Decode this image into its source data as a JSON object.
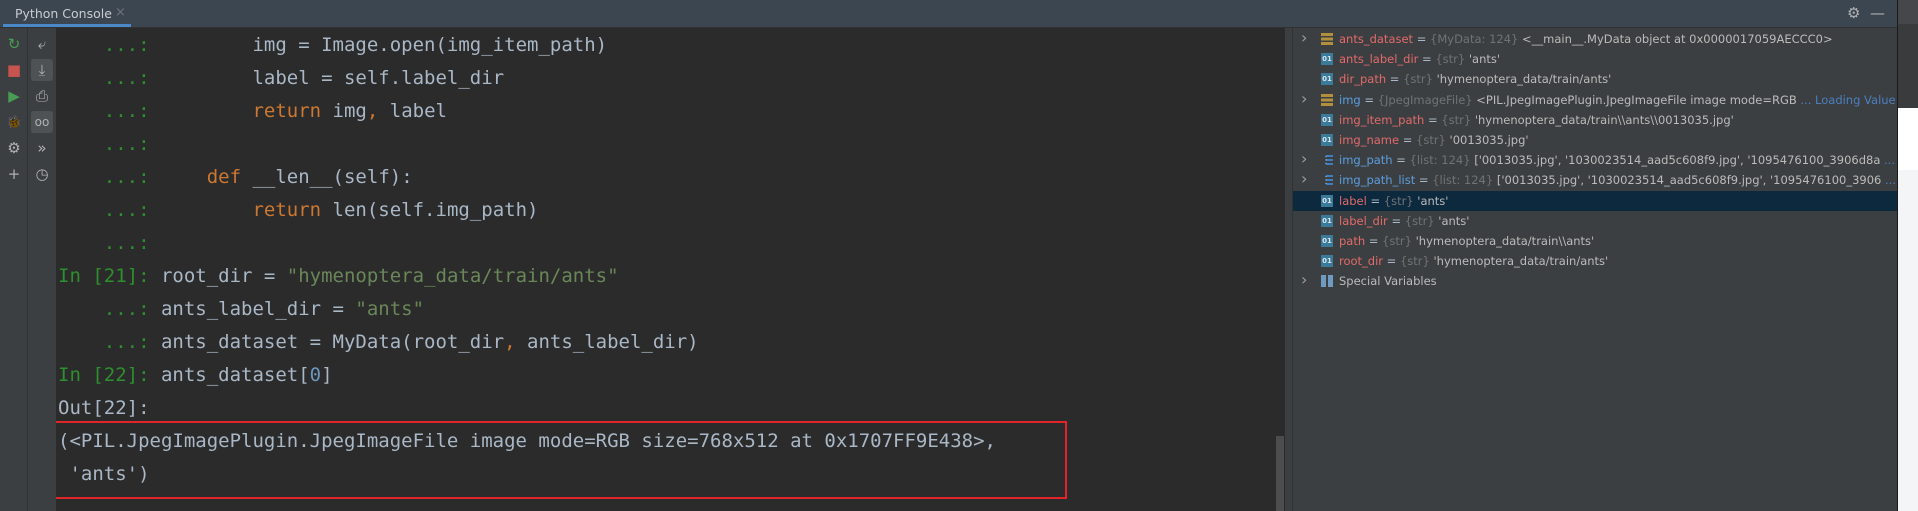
{
  "header": {
    "tab_label": "Python Console",
    "tab_close_icon": "×",
    "settings_icon": "⚙",
    "minimize_icon": "—"
  },
  "toolbar": {
    "primary": [
      {
        "name": "rerun-icon",
        "glyph": "↻",
        "color": "#499c54"
      },
      {
        "name": "stop-icon",
        "glyph": "■",
        "color": "#c75450"
      },
      {
        "name": "execute-icon",
        "glyph": "▶",
        "color": "#499c54"
      },
      {
        "name": "debug-icon",
        "glyph": "🐞",
        "color": "#499c54"
      },
      {
        "name": "settings-icon",
        "glyph": "⚙",
        "color": "#afb1b3"
      },
      {
        "name": "add-icon",
        "glyph": "+",
        "color": "#afb1b3"
      }
    ],
    "secondary": [
      {
        "name": "soft-wrap-icon",
        "glyph": "⤶",
        "active": false
      },
      {
        "name": "scroll-to-end-icon",
        "glyph": "⤓",
        "active": true
      },
      {
        "name": "print-icon",
        "glyph": "⎙",
        "active": false
      },
      {
        "name": "show-variables-icon",
        "glyph": "oo",
        "active": true
      },
      {
        "name": "execute-history-icon",
        "glyph": "»",
        "active": false
      },
      {
        "name": "history-icon",
        "glyph": "◷",
        "active": false
      }
    ]
  },
  "console": {
    "lines": [
      {
        "prompt": "    ...: ",
        "indent": "        ",
        "segments": [
          [
            "img = Image.open(img_item_path)",
            "code"
          ]
        ]
      },
      {
        "prompt": "    ...: ",
        "indent": "        ",
        "segments": [
          [
            "label = self.label_dir",
            "code"
          ]
        ]
      },
      {
        "prompt": "    ...: ",
        "indent": "        ",
        "segments": [
          [
            "return",
            "kw"
          ],
          [
            " img",
            "code"
          ],
          [
            ",",
            "kw"
          ],
          [
            " label",
            "code"
          ]
        ]
      },
      {
        "prompt": "    ...: ",
        "indent": "",
        "segments": []
      },
      {
        "prompt": "    ...: ",
        "indent": "    ",
        "segments": [
          [
            "def",
            "kw"
          ],
          [
            " __len__(self):",
            "code"
          ]
        ]
      },
      {
        "prompt": "    ...: ",
        "indent": "        ",
        "segments": [
          [
            "return",
            "kw"
          ],
          [
            " len(self.img_path)",
            "code"
          ]
        ]
      },
      {
        "prompt": "    ...: ",
        "indent": "",
        "segments": []
      },
      {
        "prompt": "In [21]: ",
        "indent": "",
        "segments": [
          [
            "root_dir = ",
            "code"
          ],
          [
            "\"hymenoptera_data/train/ants\"",
            "str"
          ]
        ]
      },
      {
        "prompt": "    ...: ",
        "indent": "",
        "segments": [
          [
            "ants_label_dir = ",
            "code"
          ],
          [
            "\"ants\"",
            "str"
          ]
        ]
      },
      {
        "prompt": "    ...: ",
        "indent": "",
        "segments": [
          [
            "ants_dataset = MyData(root_dir",
            "code"
          ],
          [
            ",",
            "kw"
          ],
          [
            " ants_label_dir)",
            "code"
          ]
        ]
      },
      {
        "prompt": "In [22]: ",
        "indent": "",
        "segments": [
          [
            "ants_dataset[",
            "code"
          ],
          [
            "0",
            "num"
          ],
          [
            "]",
            "code"
          ]
        ]
      },
      {
        "prompt": "",
        "indent": "",
        "segments": [
          [
            "Out[22]:",
            "out"
          ]
        ]
      },
      {
        "prompt": "",
        "indent": "",
        "segments": [
          [
            "(<PIL.JpegImagePlugin.JpegImageFile image mode=RGB size=768x512 at 0x1707FF9E438>,",
            "out"
          ]
        ]
      },
      {
        "prompt": "",
        "indent": "",
        "segments": [
          [
            " 'ants')",
            "out"
          ]
        ]
      }
    ],
    "highlight_color": "#e0242a"
  },
  "variables": [
    {
      "expandable": true,
      "icon": "obj",
      "name": "ants_dataset",
      "name_color": "red",
      "type": "{MyData: 124}",
      "value": "<__main__.MyData object at 0x0000017059AECCC0>",
      "link": ""
    },
    {
      "expandable": false,
      "icon": "str",
      "name": "ants_label_dir",
      "name_color": "red",
      "type": "{str}",
      "value": "'ants'",
      "link": ""
    },
    {
      "expandable": false,
      "icon": "str",
      "name": "dir_path",
      "name_color": "red",
      "type": "{str}",
      "value": "'hymenoptera_data/train/ants'",
      "link": ""
    },
    {
      "expandable": true,
      "icon": "obj",
      "name": "img",
      "name_color": "blue",
      "type": "{JpegImageFile}",
      "value": "<PIL.JpegImagePlugin.JpegImageFile image mode=RGB",
      "link": "... Loading Value"
    },
    {
      "expandable": false,
      "icon": "str",
      "name": "img_item_path",
      "name_color": "red",
      "type": "{str}",
      "value": "'hymenoptera_data/train\\\\ants\\\\0013035.jpg'",
      "link": ""
    },
    {
      "expandable": false,
      "icon": "str",
      "name": "img_name",
      "name_color": "red",
      "type": "{str}",
      "value": "'0013035.jpg'",
      "link": ""
    },
    {
      "expandable": true,
      "icon": "list",
      "name": "img_path",
      "name_color": "blue",
      "type": "{list: 124}",
      "value": "['0013035.jpg', '1030023514_aad5c608f9.jpg', '1095476100_3906d8a",
      "link": "... View"
    },
    {
      "expandable": true,
      "icon": "list",
      "name": "img_path_list",
      "name_color": "blue",
      "type": "{list: 124}",
      "value": "['0013035.jpg', '1030023514_aad5c608f9.jpg', '1095476100_3906",
      "link": "... View"
    },
    {
      "expandable": false,
      "icon": "str",
      "name": "label",
      "name_color": "red",
      "type": "{str}",
      "value": "'ants'",
      "link": "",
      "selected": true
    },
    {
      "expandable": false,
      "icon": "str",
      "name": "label_dir",
      "name_color": "red",
      "type": "{str}",
      "value": "'ants'",
      "link": ""
    },
    {
      "expandable": false,
      "icon": "str",
      "name": "path",
      "name_color": "red",
      "type": "{str}",
      "value": "'hymenoptera_data/train\\\\ants'",
      "link": ""
    },
    {
      "expandable": false,
      "icon": "str",
      "name": "root_dir",
      "name_color": "red",
      "type": "{str}",
      "value": "'hymenoptera_data/train/ants'",
      "link": ""
    },
    {
      "expandable": true,
      "icon": "spec",
      "name": "Special Variables",
      "name_color": "plain",
      "type": "",
      "value": "",
      "link": ""
    }
  ],
  "str_icon_label": "01"
}
